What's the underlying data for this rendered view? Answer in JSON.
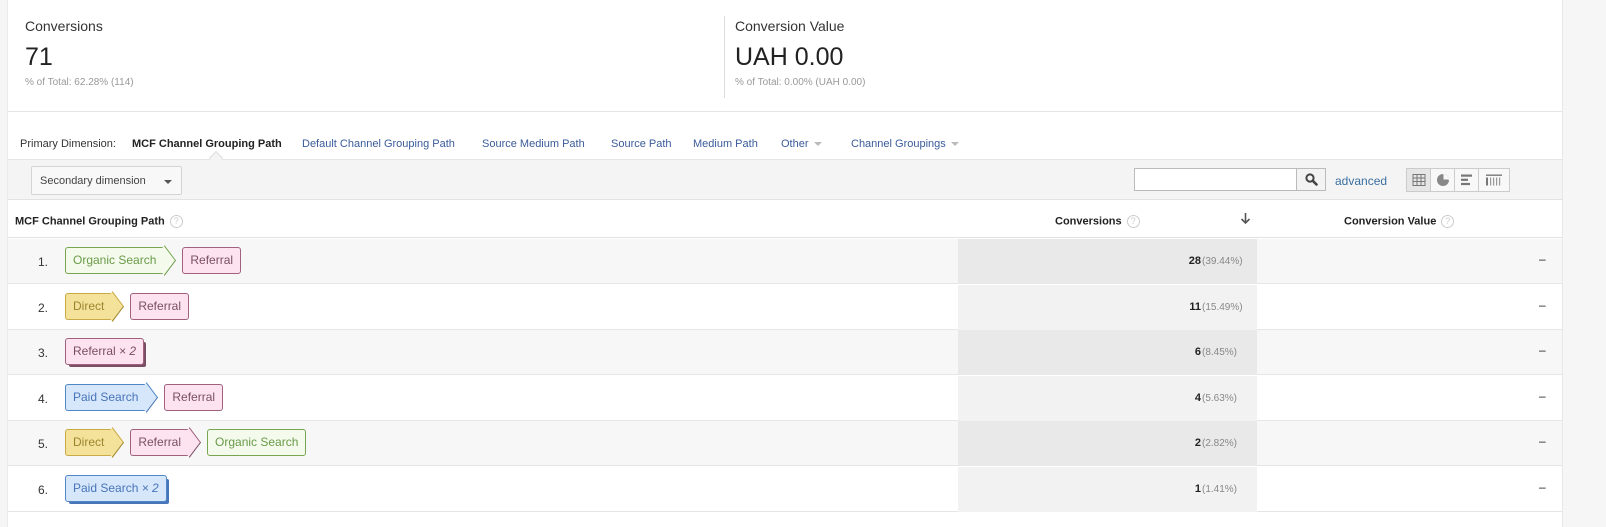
{
  "scorecards": [
    {
      "title": "Conversions",
      "value": "71",
      "sub": "% of Total: 62.28% (114)"
    },
    {
      "title": "Conversion Value",
      "value": "UAH 0.00",
      "sub": "% of Total: 0.00% (UAH 0.00)"
    }
  ],
  "primary_dimension": {
    "label": "Primary Dimension:",
    "active": "MCF Channel Grouping Path",
    "links": [
      "Default Channel Grouping Path",
      "Source Medium Path",
      "Source Path",
      "Medium Path"
    ],
    "other": "Other",
    "channel_groupings": "Channel Groupings"
  },
  "toolbar": {
    "secondary_dimension": "Secondary dimension",
    "search_value": "",
    "search_placeholder": "",
    "advanced": "advanced",
    "view_icons": [
      "table-view-icon",
      "pie-view-icon",
      "performance-view-icon",
      "pivot-view-icon"
    ]
  },
  "table": {
    "headers": {
      "path": "MCF Channel Grouping Path",
      "conversions": "Conversions",
      "conversion_value": "Conversion Value",
      "help": "?"
    },
    "sort": "descending",
    "rows": [
      {
        "index": "1.",
        "path": [
          {
            "label": "Organic Search",
            "type": "organic"
          },
          {
            "label": "Referral",
            "type": "referral"
          }
        ],
        "conversions": "28",
        "pct": "(39.44%)",
        "value": "–"
      },
      {
        "index": "2.",
        "path": [
          {
            "label": "Direct",
            "type": "direct"
          },
          {
            "label": "Referral",
            "type": "referral"
          }
        ],
        "conversions": "11",
        "pct": "(15.49%)",
        "value": "–"
      },
      {
        "index": "3.",
        "path": [
          {
            "label": "Referral",
            "type": "referral",
            "mult": "× 2"
          }
        ],
        "conversions": "6",
        "pct": "(8.45%)",
        "value": "–"
      },
      {
        "index": "4.",
        "path": [
          {
            "label": "Paid Search",
            "type": "paid"
          },
          {
            "label": "Referral",
            "type": "referral"
          }
        ],
        "conversions": "4",
        "pct": "(5.63%)",
        "value": "–"
      },
      {
        "index": "5.",
        "path": [
          {
            "label": "Direct",
            "type": "direct"
          },
          {
            "label": "Referral",
            "type": "referral"
          },
          {
            "label": "Organic Search",
            "type": "organic"
          }
        ],
        "conversions": "2",
        "pct": "(2.82%)",
        "value": "–"
      },
      {
        "index": "6.",
        "path": [
          {
            "label": "Paid Search",
            "type": "paid",
            "mult": "× 2"
          }
        ],
        "conversions": "1",
        "pct": "(1.41%)",
        "value": "–"
      }
    ]
  },
  "colors": {
    "organic": "#77a651",
    "referral": "#a0607e",
    "direct": "#c9aa45",
    "paid": "#4f86c6",
    "link": "#3a5b9a"
  }
}
